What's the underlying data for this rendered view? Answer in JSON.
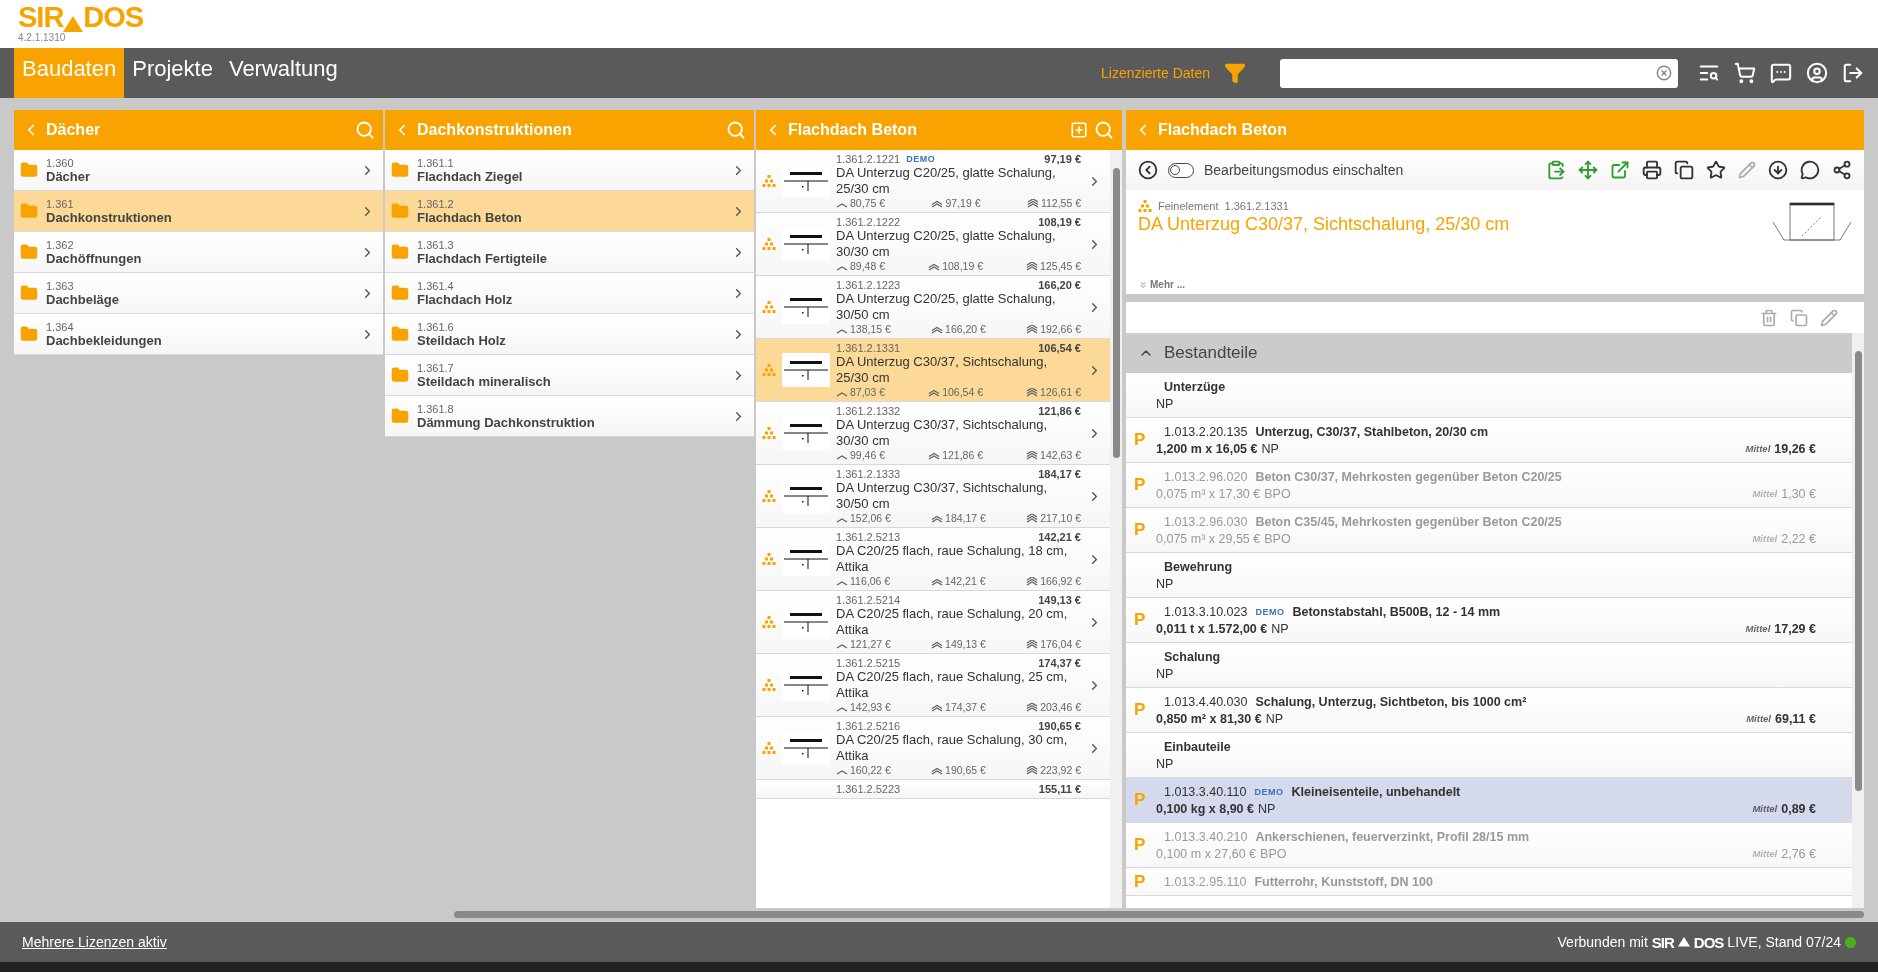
{
  "header": {
    "logo_left": "SIR",
    "logo_right": "DOS",
    "version": "4.2.1.1310"
  },
  "nav": {
    "tabs": [
      {
        "label": "Baudaten",
        "selected": true
      },
      {
        "label": "Projekte",
        "selected": false
      },
      {
        "label": "Verwaltung",
        "selected": false
      }
    ],
    "license_filter": "Lizenzierte Daten"
  },
  "columns": [
    {
      "title": "Dächer",
      "items": [
        {
          "code": "1.360",
          "name": "Dächer",
          "selected": false
        },
        {
          "code": "1.361",
          "name": "Dachkonstruktionen",
          "selected": true
        },
        {
          "code": "1.362",
          "name": "Dachöffnungen",
          "selected": false
        },
        {
          "code": "1.363",
          "name": "Dachbeläge",
          "selected": false
        },
        {
          "code": "1.364",
          "name": "Dachbekleidungen",
          "selected": false
        }
      ]
    },
    {
      "title": "Dachkonstruktionen",
      "items": [
        {
          "code": "1.361.1",
          "name": "Flachdach Ziegel",
          "selected": false
        },
        {
          "code": "1.361.2",
          "name": "Flachdach Beton",
          "selected": true
        },
        {
          "code": "1.361.3",
          "name": "Flachdach Fertigteile",
          "selected": false
        },
        {
          "code": "1.361.4",
          "name": "Flachdach Holz",
          "selected": false
        },
        {
          "code": "1.361.6",
          "name": "Steildach Holz",
          "selected": false
        },
        {
          "code": "1.361.7",
          "name": "Steildach mineralisch",
          "selected": false
        },
        {
          "code": "1.361.8",
          "name": "Dämmung Dachkonstruktion",
          "selected": false
        }
      ]
    }
  ],
  "elements": {
    "title": "Flachdach Beton",
    "items": [
      {
        "code": "1.361.2.1221",
        "demo": "DEMO",
        "price": "97,19 €",
        "title": "DA Unterzug C20/25, glatte Schalung, 25/30 cm",
        "min": "80,75 €",
        "mid": "97,19 €",
        "max": "112,55 €",
        "selected": false
      },
      {
        "code": "1.361.2.1222",
        "price": "108,19 €",
        "title": "DA Unterzug C20/25, glatte Schalung, 30/30 cm",
        "min": "89,48 €",
        "mid": "108,19 €",
        "max": "125,45 €",
        "selected": false
      },
      {
        "code": "1.361.2.1223",
        "price": "166,20 €",
        "title": "DA Unterzug C20/25, glatte Schalung, 30/50 cm",
        "min": "138,15 €",
        "mid": "166,20 €",
        "max": "192,66 €",
        "selected": false
      },
      {
        "code": "1.361.2.1331",
        "price": "106,54 €",
        "title": "DA Unterzug C30/37, Sichtschalung, 25/30 cm",
        "min": "87,03 €",
        "mid": "106,54 €",
        "max": "126,61 €",
        "selected": true
      },
      {
        "code": "1.361.2.1332",
        "price": "121,86 €",
        "title": "DA Unterzug C30/37, Sichtschalung, 30/30 cm",
        "min": "99,46 €",
        "mid": "121,86 €",
        "max": "142,63 €",
        "selected": false
      },
      {
        "code": "1.361.2.1333",
        "price": "184,17 €",
        "title": "DA Unterzug C30/37, Sichtschalung, 30/50 cm",
        "min": "152,06 €",
        "mid": "184,17 €",
        "max": "217,10 €",
        "selected": false
      },
      {
        "code": "1.361.2.5213",
        "price": "142,21 €",
        "title": "DA C20/25 flach, raue Schalung, 18 cm, Attika",
        "min": "116,06 €",
        "mid": "142,21 €",
        "max": "166,92 €",
        "selected": false
      },
      {
        "code": "1.361.2.5214",
        "price": "149,13 €",
        "title": "DA C20/25 flach, raue Schalung, 20 cm, Attika",
        "min": "121,27 €",
        "mid": "149,13 €",
        "max": "176,04 €",
        "selected": false
      },
      {
        "code": "1.361.2.5215",
        "price": "174,37 €",
        "title": "DA C20/25 flach, raue Schalung, 25 cm, Attika",
        "min": "142,93 €",
        "mid": "174,37 €",
        "max": "203,46 €",
        "selected": false
      },
      {
        "code": "1.361.2.5216",
        "price": "190,65 €",
        "title": "DA C20/25 flach, raue Schalung, 30 cm, Attika",
        "min": "160,22 €",
        "mid": "190,65 €",
        "max": "223,92 €",
        "selected": false
      },
      {
        "code": "1.361.2.5223",
        "price": "155,11 €",
        "selected": false
      }
    ]
  },
  "detail": {
    "title": "Flachdach Beton",
    "edit_mode": {
      "label": "Bearbeitungsmodus einschalten",
      "on": false
    },
    "type": "Feinelement",
    "code": "1.361.2.1331",
    "name": "DA Unterzug C30/37, Sichtschalung, 25/30 cm",
    "more": "Mehr ...",
    "section": "Bestandteile",
    "expanded": true,
    "items": [
      {
        "kind": "group",
        "name": "Unterzüge",
        "unit": "NP"
      },
      {
        "kind": "position",
        "mark": "P",
        "code": "1.013.2.20.135",
        "title": "Unterzug, C30/37, Stahlbeton, 20/30 cm",
        "qty": "1,200 m x 16,05 €",
        "unit": "NP",
        "avg": "Mittel",
        "total": "19,26 €",
        "dimmed": false,
        "selected": false
      },
      {
        "kind": "position",
        "mark": "P",
        "code": "1.013.2.96.020",
        "title": "Beton C30/37, Mehrkosten gegenüber Beton C20/25",
        "qty": "0,075 m³ x 17,30 €",
        "unit": "BPO",
        "avg": "Mittel",
        "total": "1,30 €",
        "dimmed": true,
        "selected": false
      },
      {
        "kind": "position",
        "mark": "P",
        "code": "1.013.2.96.030",
        "title": "Beton C35/45, Mehrkosten gegenüber Beton C20/25",
        "qty": "0,075 m³ x 29,55 €",
        "unit": "BPO",
        "avg": "Mittel",
        "total": "2,22 €",
        "dimmed": true,
        "selected": false
      },
      {
        "kind": "group",
        "name": "Bewehrung",
        "unit": "NP"
      },
      {
        "kind": "position",
        "mark": "P",
        "code": "1.013.3.10.023",
        "demo": "DEMO",
        "title": "Betonstabstahl, B500B, 12 - 14 mm",
        "qty": "0,011 t x 1.572,00 €",
        "unit": "NP",
        "avg": "Mittel",
        "total": "17,29 €",
        "dimmed": false,
        "selected": false
      },
      {
        "kind": "group",
        "name": "Schalung",
        "unit": "NP"
      },
      {
        "kind": "position",
        "mark": "P",
        "code": "1.013.4.40.030",
        "title": "Schalung, Unterzug, Sichtbeton, bis 1000 cm²",
        "qty": "0,850 m² x 81,30 €",
        "unit": "NP",
        "avg": "Mittel",
        "total": "69,11 €",
        "dimmed": false,
        "selected": false
      },
      {
        "kind": "group",
        "name": "Einbauteile",
        "unit": "NP"
      },
      {
        "kind": "position",
        "mark": "P",
        "code": "1.013.3.40.110",
        "demo": "DEMO",
        "title": "Kleineisenteile, unbehandelt",
        "qty": "0,100 kg x 8,90 €",
        "unit": "NP",
        "avg": "Mittel",
        "total": "0,89 €",
        "dimmed": false,
        "selected": true
      },
      {
        "kind": "position",
        "mark": "P",
        "code": "1.013.3.40.210",
        "title": "Ankerschienen, feuerverzinkt, Profil 28/15 mm",
        "qty": "0,100 m x 27,60 €",
        "unit": "BPO",
        "avg": "Mittel",
        "total": "2,76 €",
        "dimmed": true,
        "selected": false
      },
      {
        "kind": "position",
        "mark": "P",
        "code": "1.013.2.95.110",
        "title": "Futterrohr, Kunststoff, DN 100",
        "dimmed": true,
        "selected": false
      }
    ]
  },
  "footer": {
    "licenses": "Mehrere Lizenzen aktiv",
    "prefix": "Verbunden mit",
    "brand_left": "SIR",
    "brand_right": "DOS",
    "suffix": "LIVE, Stand 07/24",
    "connected": true
  }
}
